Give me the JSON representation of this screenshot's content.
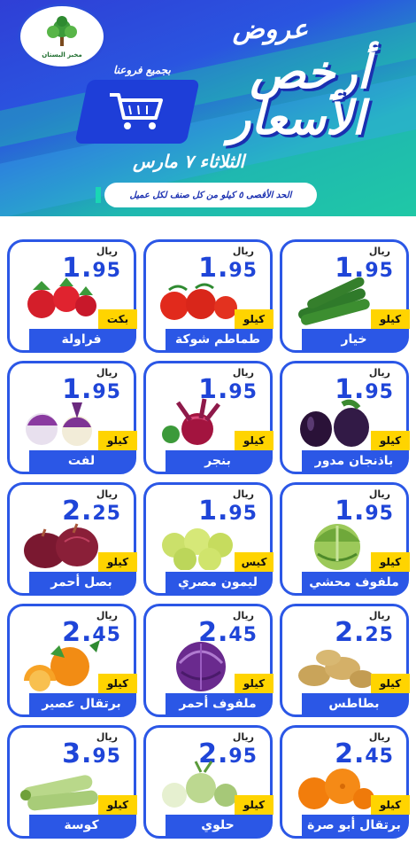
{
  "header": {
    "logo_text": "مخبز البستان",
    "offers_word": "عروض",
    "title_line1": "أرخص",
    "title_line2": "الأسعار",
    "branches_text": "بجميع فروعنا",
    "date_text": "الثلاثاء ٧ مارس",
    "limit_text": "الحد الأقصى ٥ كيلو من كل صنف لكل عميل",
    "colors": {
      "banner_blue": "#2a55e0",
      "banner_teal": "#1fc8a6",
      "accent_yellow": "#ffd400"
    }
  },
  "products": [
    {
      "name": "فراولة",
      "unit": "بكت",
      "riyal": "ريال",
      "price_int": "1.",
      "price_dec": "95",
      "icon": "strawberry-icon"
    },
    {
      "name": "طماطم شوكة",
      "unit": "كيلو",
      "riyal": "ريال",
      "price_int": "1.",
      "price_dec": "95",
      "icon": "tomato-icon"
    },
    {
      "name": "خيار",
      "unit": "كيلو",
      "riyal": "ريال",
      "price_int": "1.",
      "price_dec": "95",
      "icon": "cucumber-icon"
    },
    {
      "name": "لفت",
      "unit": "كيلو",
      "riyal": "ريال",
      "price_int": "1.",
      "price_dec": "95",
      "icon": "turnip-icon"
    },
    {
      "name": "بنجر",
      "unit": "كيلو",
      "riyal": "ريال",
      "price_int": "1.",
      "price_dec": "95",
      "icon": "beetroot-icon"
    },
    {
      "name": "باذنجان مدور",
      "unit": "كيلو",
      "riyal": "ريال",
      "price_int": "1.",
      "price_dec": "95",
      "icon": "eggplant-icon"
    },
    {
      "name": "بصل أحمر",
      "unit": "كيلو",
      "riyal": "ريال",
      "price_int": "2.",
      "price_dec": "25",
      "icon": "red-onion-icon"
    },
    {
      "name": "ليمون مصري",
      "unit": "كيس",
      "riyal": "ريال",
      "price_int": "1.",
      "price_dec": "95",
      "icon": "lime-icon"
    },
    {
      "name": "ملفوف محشي",
      "unit": "كيلو",
      "riyal": "ريال",
      "price_int": "1.",
      "price_dec": "95",
      "icon": "cabbage-icon"
    },
    {
      "name": "برتقال عصير",
      "unit": "كيلو",
      "riyal": "ريال",
      "price_int": "2.",
      "price_dec": "45",
      "icon": "orange-icon"
    },
    {
      "name": "ملفوف أحمر",
      "unit": "كيلو",
      "riyal": "ريال",
      "price_int": "2.",
      "price_dec": "45",
      "icon": "red-cabbage-icon"
    },
    {
      "name": "بطاطس",
      "unit": "كيلو",
      "riyal": "ريال",
      "price_int": "2.",
      "price_dec": "25",
      "icon": "potato-icon"
    },
    {
      "name": "كوسة",
      "unit": "كيلو",
      "riyal": "ريال",
      "price_int": "3.",
      "price_dec": "95",
      "icon": "zucchini-icon"
    },
    {
      "name": "حلوي",
      "unit": "كيلو",
      "riyal": "ريال",
      "price_int": "2.",
      "price_dec": "95",
      "icon": "kohlrabi-icon"
    },
    {
      "name": "برتقال أبو صرة",
      "unit": "كيلو",
      "riyal": "ريال",
      "price_int": "2.",
      "price_dec": "45",
      "icon": "navel-orange-icon"
    }
  ]
}
